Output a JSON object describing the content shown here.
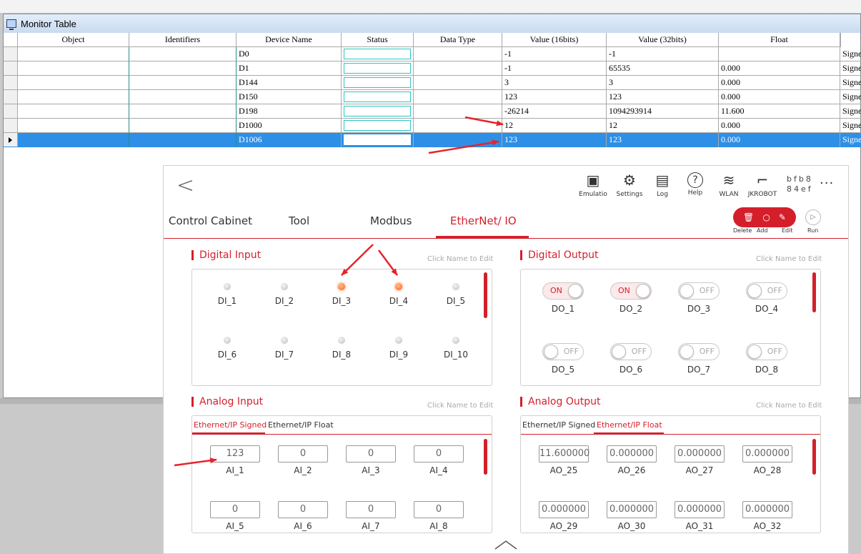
{
  "monitor": {
    "title": "Monitor Table",
    "columns": [
      "Object",
      "Identifiers",
      "Device Name",
      "Status",
      "Data Type",
      "Value (16bits)",
      "Value (32bits)",
      "Float",
      ""
    ],
    "rows": [
      {
        "device": "D0",
        "v16": "-1",
        "v32": "-1",
        "float": "",
        "type": "Signe"
      },
      {
        "device": "D1",
        "v16": "-1",
        "v32": "65535",
        "float": "0.000",
        "type": "Signe"
      },
      {
        "device": "D144",
        "v16": "3",
        "v32": "3",
        "float": "0.000",
        "type": "Signe"
      },
      {
        "device": "D150",
        "v16": "123",
        "v32": "123",
        "float": "0.000",
        "type": "Signe"
      },
      {
        "device": "D198",
        "v16": "-26214",
        "v32": "1094293914",
        "float": "11.600",
        "type": "Signe"
      },
      {
        "device": "D1000",
        "v16": "12",
        "v32": "12",
        "float": "0.000",
        "type": "Signe"
      },
      {
        "device": "D1006",
        "v16": "123",
        "v32": "123",
        "float": "0.000",
        "type": "Signe"
      }
    ],
    "selected_row": 6
  },
  "toolbar": {
    "items": [
      {
        "icon": "emulation-icon",
        "label": "Emulatio"
      },
      {
        "icon": "settings-gear-icon",
        "label": "Settings"
      },
      {
        "icon": "log-icon",
        "label": "Log"
      },
      {
        "icon": "help-icon",
        "label": "Help"
      },
      {
        "icon": "wlan-icon",
        "label": "WLAN"
      },
      {
        "icon": "robot-arm-icon",
        "label": "JKROBOT"
      }
    ],
    "serial": "bfb8\n84ef",
    "more": "···"
  },
  "tabs": [
    "Control Cabinet",
    "Tool",
    "Modbus",
    "EtherNet/ IO"
  ],
  "active_tab": 3,
  "actions": {
    "delete": "Delete",
    "add": "Add",
    "edit": "Edit",
    "run": "Run"
  },
  "digital_input": {
    "title": "Digital Input",
    "hint": "Click Name to Edit",
    "items": [
      {
        "label": "DI_1",
        "on": false
      },
      {
        "label": "DI_2",
        "on": false
      },
      {
        "label": "DI_3",
        "on": true
      },
      {
        "label": "DI_4",
        "on": true
      },
      {
        "label": "DI_5",
        "on": false
      },
      {
        "label": "DI_6",
        "on": false
      },
      {
        "label": "DI_7",
        "on": false
      },
      {
        "label": "DI_8",
        "on": false
      },
      {
        "label": "DI_9",
        "on": false
      },
      {
        "label": "DI_10",
        "on": false
      }
    ]
  },
  "digital_output": {
    "title": "Digital Output",
    "hint": "Click Name to Edit",
    "on_text": "ON",
    "off_text": "OFF",
    "items": [
      {
        "label": "DO_1",
        "on": true
      },
      {
        "label": "DO_2",
        "on": true
      },
      {
        "label": "DO_3",
        "on": false
      },
      {
        "label": "DO_4",
        "on": false
      },
      {
        "label": "DO_5",
        "on": false
      },
      {
        "label": "DO_6",
        "on": false
      },
      {
        "label": "DO_7",
        "on": false
      },
      {
        "label": "DO_8",
        "on": false
      }
    ]
  },
  "analog_input": {
    "title": "Analog Input",
    "hint": "Click Name to Edit",
    "tabs": [
      "Ethernet/IP Signed",
      "Ethernet/IP Float"
    ],
    "active_tab": 0,
    "items": [
      {
        "label": "AI_1",
        "value": "123"
      },
      {
        "label": "AI_2",
        "value": "0"
      },
      {
        "label": "AI_3",
        "value": "0"
      },
      {
        "label": "AI_4",
        "value": "0"
      },
      {
        "label": "AI_5",
        "value": "0"
      },
      {
        "label": "AI_6",
        "value": "0"
      },
      {
        "label": "AI_7",
        "value": "0"
      },
      {
        "label": "AI_8",
        "value": "0"
      }
    ]
  },
  "analog_output": {
    "title": "Analog Output",
    "hint": "Click Name to Edit",
    "tabs": [
      "Ethernet/IP Signed",
      "Ethernet/IP Float"
    ],
    "active_tab": 1,
    "items": [
      {
        "label": "AO_25",
        "value": "11.600000"
      },
      {
        "label": "AO_26",
        "value": "0.000000"
      },
      {
        "label": "AO_27",
        "value": "0.000000"
      },
      {
        "label": "AO_28",
        "value": "0.000000"
      },
      {
        "label": "AO_29",
        "value": "0.000000"
      },
      {
        "label": "AO_30",
        "value": "0.000000"
      },
      {
        "label": "AO_31",
        "value": "0.000000"
      },
      {
        "label": "AO_32",
        "value": "0.000000"
      }
    ]
  },
  "colors": {
    "accent": "#d41f2b",
    "selection": "#2e8fe6",
    "arrow": "#e8232b",
    "status_box": "#2bc6c6",
    "led_on": "#ff5a1a"
  }
}
